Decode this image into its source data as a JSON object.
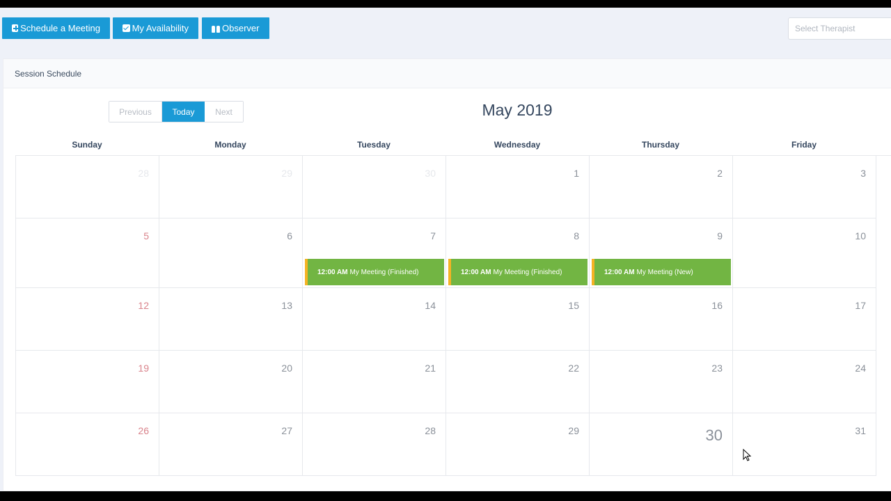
{
  "toolbar": {
    "schedule_label": "Schedule a Meeting",
    "availability_label": "My Availability",
    "observer_label": "Observer",
    "select_therapist_placeholder": "Select Therapist"
  },
  "panel": {
    "title": "Session Schedule"
  },
  "calendar": {
    "nav": {
      "previous": "Previous",
      "today": "Today",
      "next": "Next"
    },
    "month_title": "May 2019",
    "weekdays": [
      "Sunday",
      "Monday",
      "Tuesday",
      "Wednesday",
      "Thursday",
      "Friday"
    ],
    "weeks": [
      [
        {
          "day": "28",
          "other": true
        },
        {
          "day": "29",
          "other": true
        },
        {
          "day": "30",
          "other": true
        },
        {
          "day": "1"
        },
        {
          "day": "2"
        },
        {
          "day": "3"
        }
      ],
      [
        {
          "day": "5"
        },
        {
          "day": "6"
        },
        {
          "day": "7",
          "event": {
            "time": "12:00 AM",
            "title": "My Meeting (Finished)"
          }
        },
        {
          "day": "8",
          "event": {
            "time": "12:00 AM",
            "title": "My Meeting (Finished)"
          }
        },
        {
          "day": "9",
          "event": {
            "time": "12:00 AM",
            "title": "My Meeting (New)"
          }
        },
        {
          "day": "10"
        }
      ],
      [
        {
          "day": "12"
        },
        {
          "day": "13"
        },
        {
          "day": "14"
        },
        {
          "day": "15"
        },
        {
          "day": "16"
        },
        {
          "day": "17"
        }
      ],
      [
        {
          "day": "19"
        },
        {
          "day": "20"
        },
        {
          "day": "21"
        },
        {
          "day": "22"
        },
        {
          "day": "23"
        },
        {
          "day": "24"
        }
      ],
      [
        {
          "day": "26"
        },
        {
          "day": "27"
        },
        {
          "day": "28"
        },
        {
          "day": "29"
        },
        {
          "day": "30",
          "today": true
        },
        {
          "day": "31"
        }
      ]
    ]
  },
  "colors": {
    "primary": "#1a9ad6",
    "event_bg": "#72b543",
    "event_border": "#f5b324",
    "sunday_number": "#d9838b"
  }
}
